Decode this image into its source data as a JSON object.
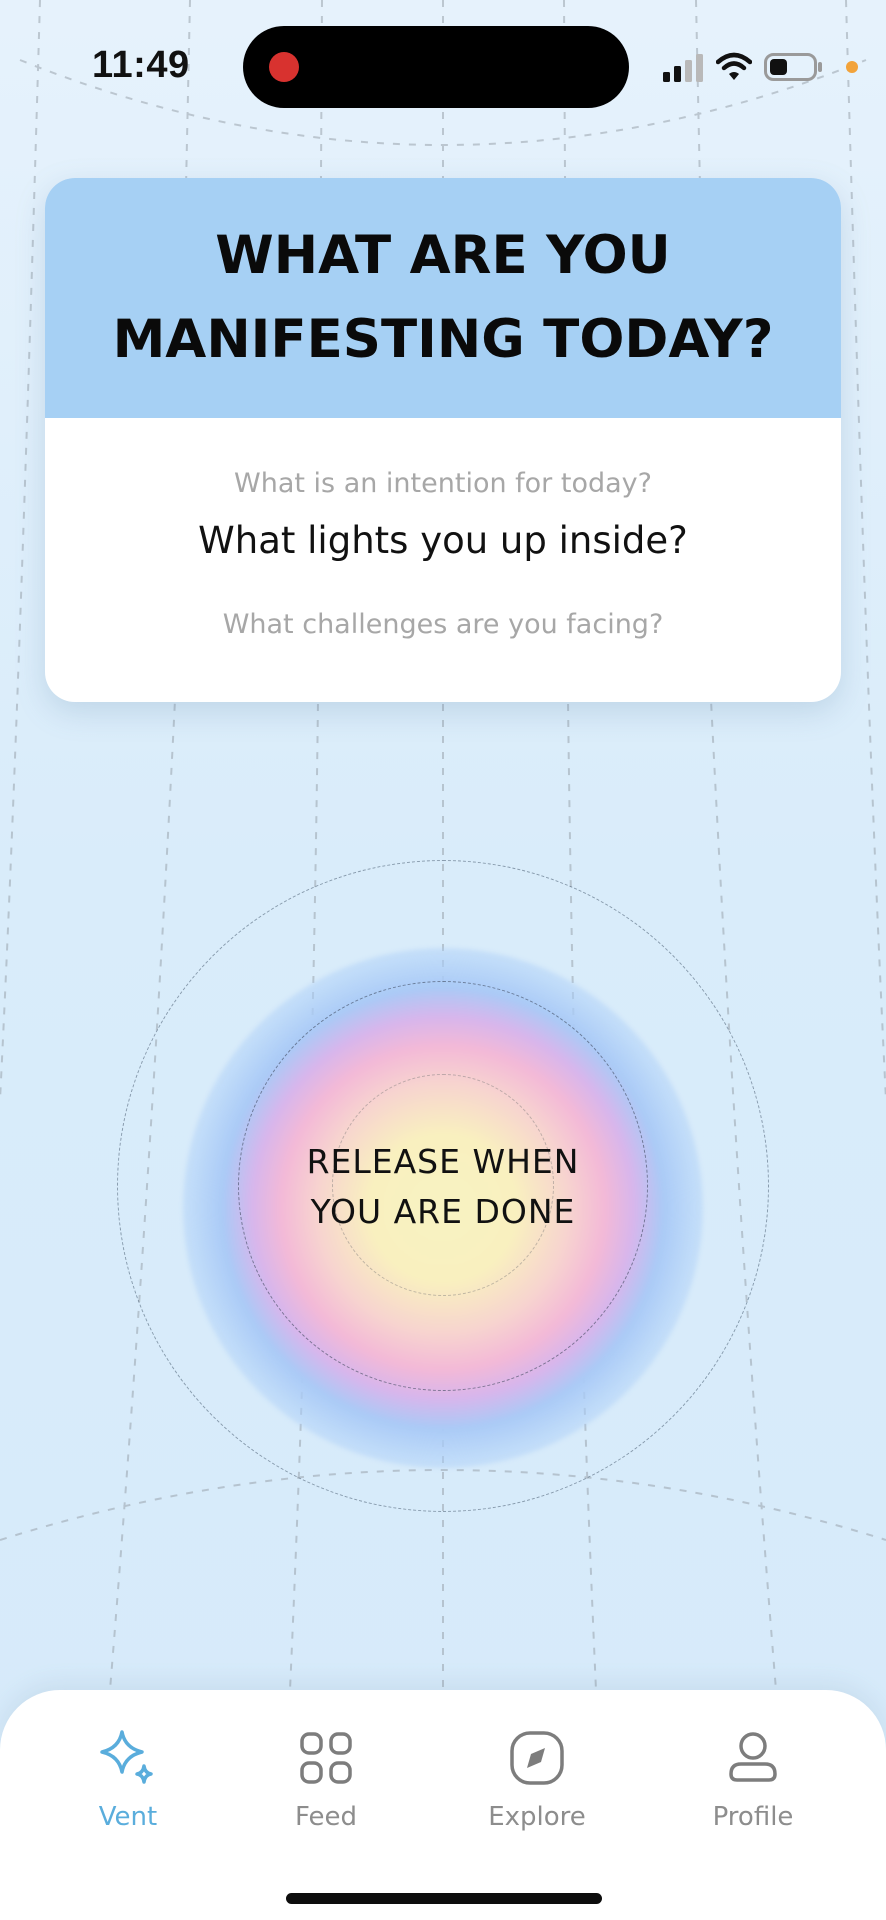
{
  "status_bar": {
    "time": "11:49",
    "recording_indicator_color": "#d8322f",
    "icons": [
      "cellular-signal-icon",
      "wifi-icon",
      "battery-icon",
      "privacy-dot-icon"
    ]
  },
  "card": {
    "title": "WHAT ARE YOU MANIFESTING TODAY?",
    "header_color": "#a6d0f4",
    "prompts": [
      {
        "text": "What is an intention for today?",
        "state": "faded"
      },
      {
        "text": "What lights you up inside?",
        "state": "selected"
      },
      {
        "text": "What challenges are you facing?",
        "state": "faded"
      }
    ]
  },
  "release_button": {
    "line1": "RELEASE WHEN",
    "line2": "YOU ARE DONE"
  },
  "tab_bar": {
    "accent_color": "#5aaddc",
    "tabs": [
      {
        "label": "Vent",
        "icon": "sparkle-icon",
        "active": true
      },
      {
        "label": "Feed",
        "icon": "grid-icon",
        "active": false
      },
      {
        "label": "Explore",
        "icon": "compass-icon",
        "active": false
      },
      {
        "label": "Profile",
        "icon": "person-icon",
        "active": false
      }
    ]
  }
}
